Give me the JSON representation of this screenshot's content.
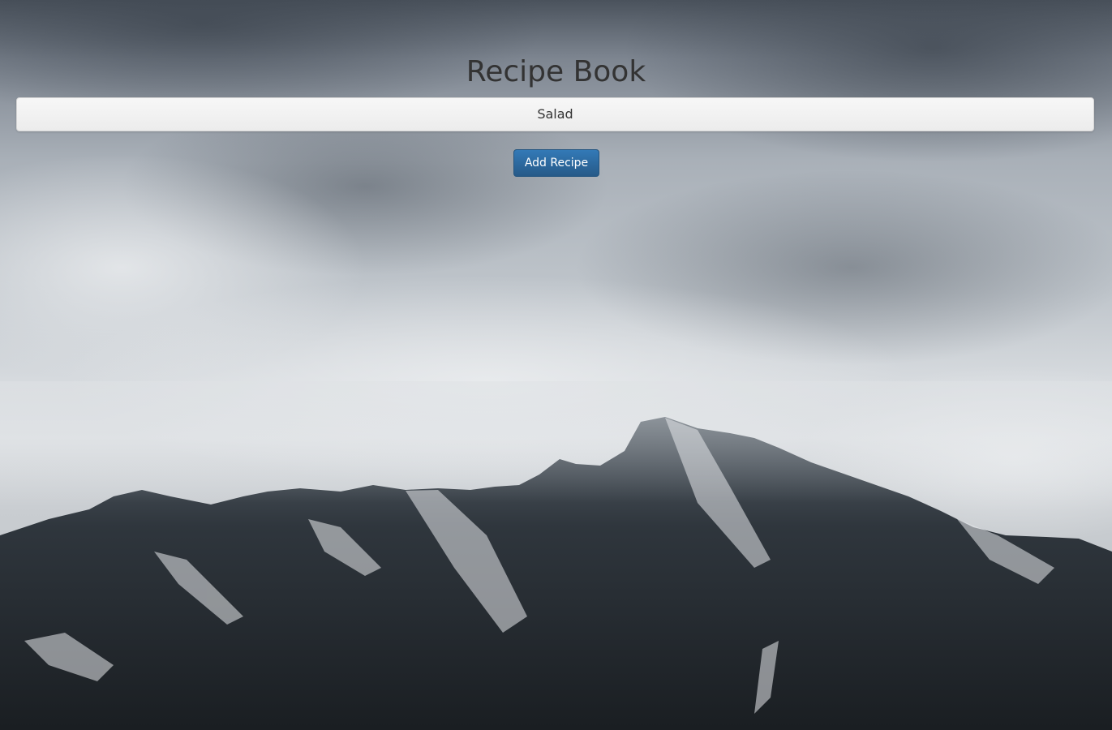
{
  "page": {
    "title": "Recipe Book"
  },
  "recipes": [
    {
      "name": "Salad"
    }
  ],
  "actions": {
    "add_label": "Add Recipe"
  },
  "colors": {
    "primary": "#337ab7",
    "title_text": "#333333",
    "list_bg": "#f1f1f1"
  },
  "background": {
    "description_icon": "mountain-landscape-image"
  }
}
